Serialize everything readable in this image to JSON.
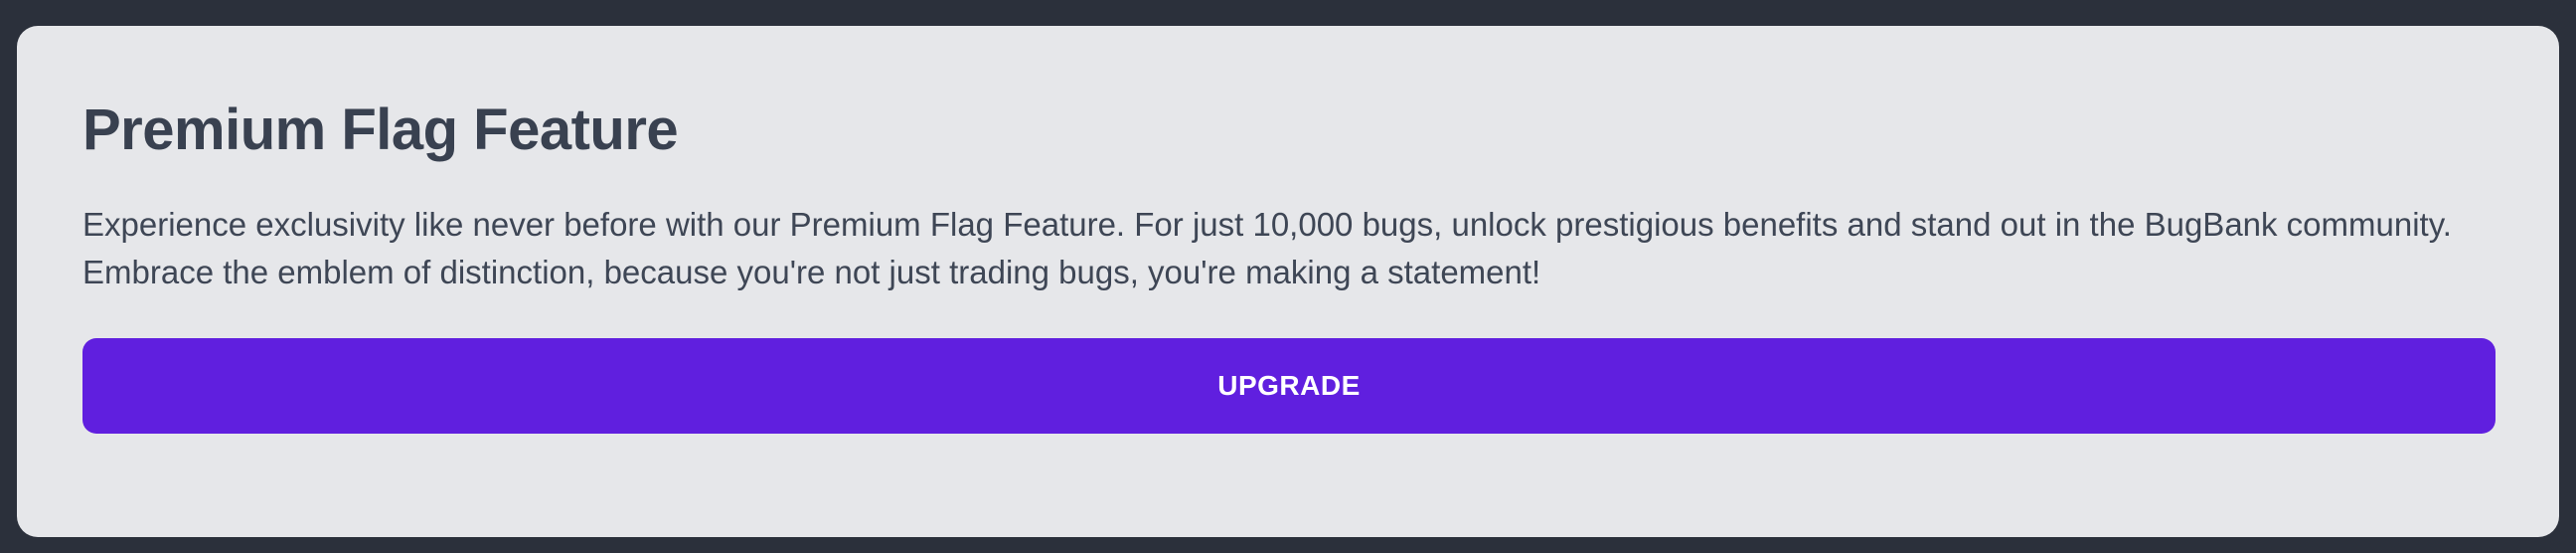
{
  "card": {
    "title": "Premium Flag Feature",
    "description": "Experience exclusivity like never before with our Premium Flag Feature. For just 10,000 bugs, unlock prestigious benefits and stand out in the BugBank community. Embrace the emblem of distinction, because you're not just trading bugs, you're making a statement!",
    "button_label": "UPGRADE"
  },
  "colors": {
    "page_background": "#2b303b",
    "card_background": "#e6e7ea",
    "title_text": "#394150",
    "button_background": "#601fdf",
    "button_text": "#ffffff"
  }
}
